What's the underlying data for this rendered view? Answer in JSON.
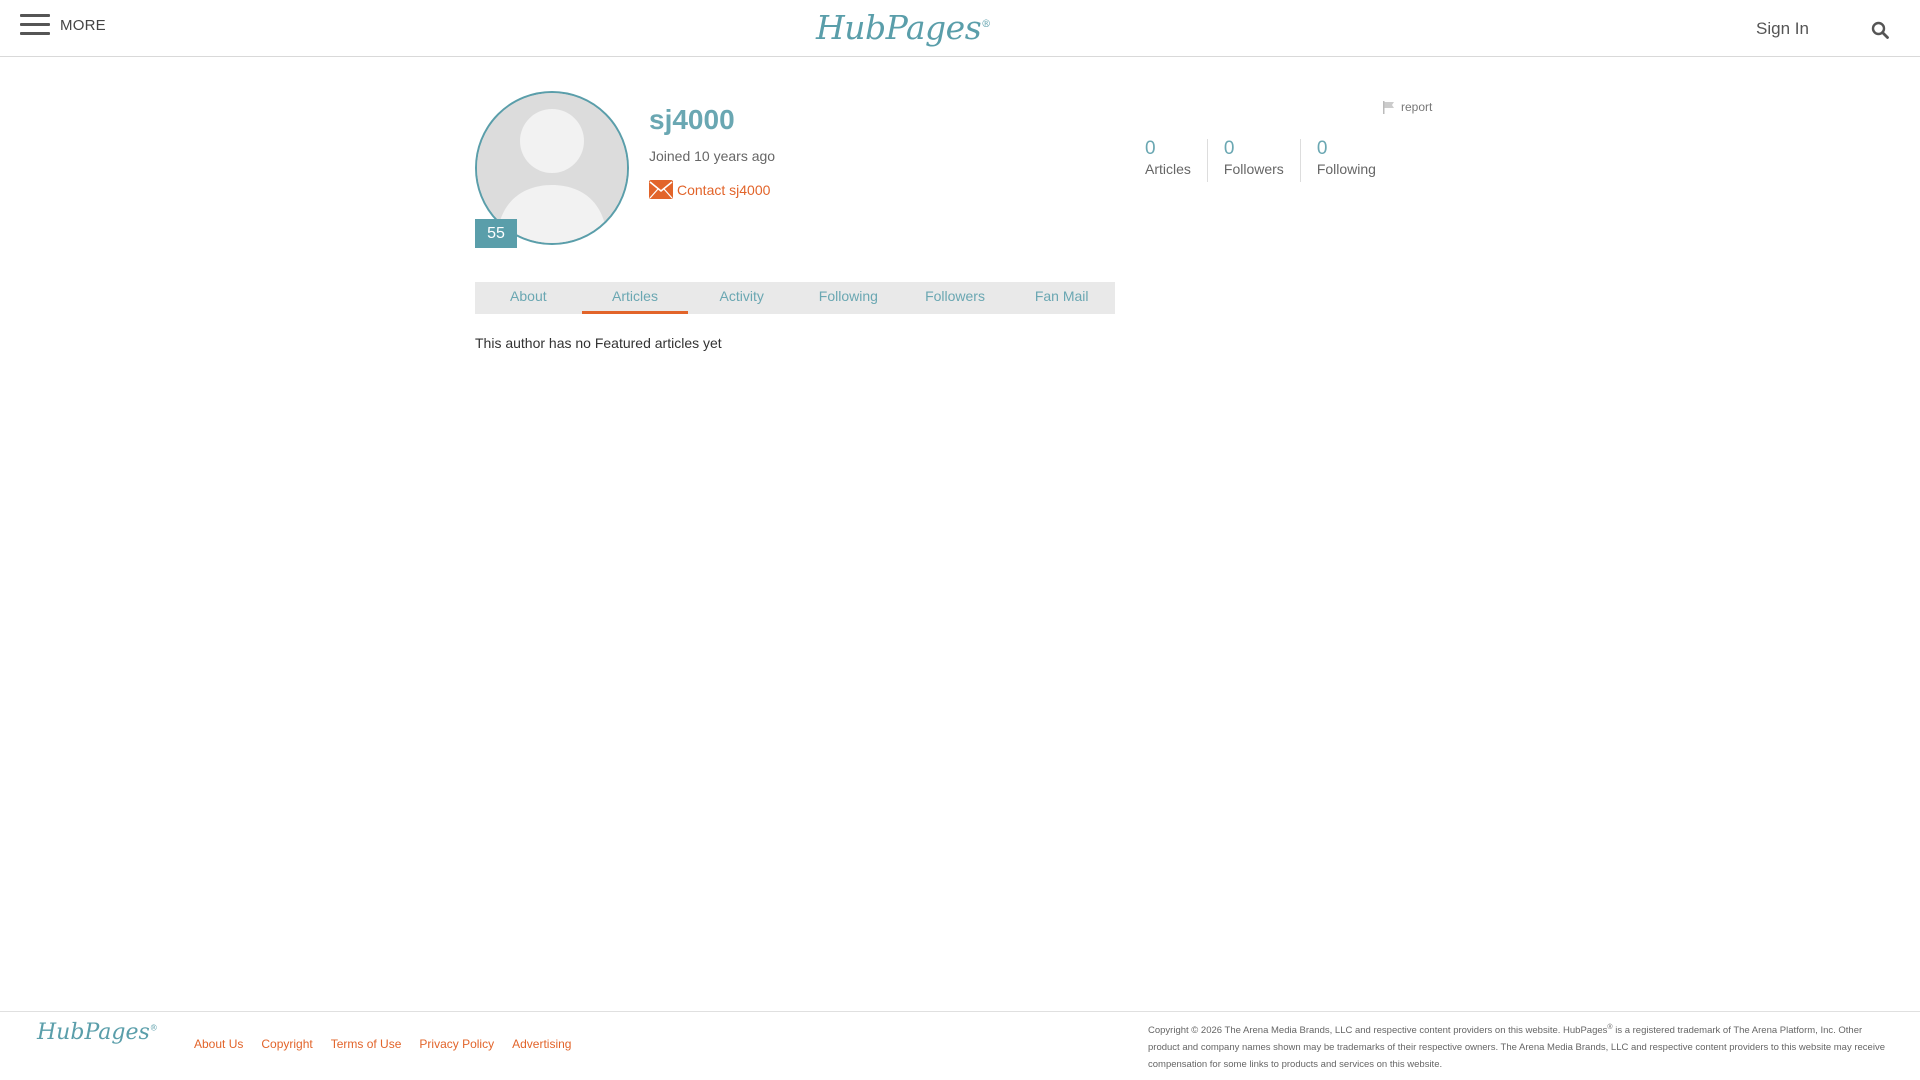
{
  "header": {
    "menu_label": "MORE",
    "logo_text": "HubPages",
    "logo_mark": "®",
    "sign_in_label": "Sign In",
    "search_icon": "search-icon"
  },
  "profile": {
    "username": "sj4000",
    "joined": "Joined 10 years ago",
    "contact_label": "Contact sj4000",
    "score": "55",
    "report_label": "report"
  },
  "stats": [
    {
      "value": "0",
      "label": "Articles"
    },
    {
      "value": "0",
      "label": "Followers"
    },
    {
      "value": "0",
      "label": "Following"
    }
  ],
  "tabs": [
    {
      "label": "About",
      "active": false
    },
    {
      "label": "Articles",
      "active": true
    },
    {
      "label": "Activity",
      "active": false
    },
    {
      "label": "Following",
      "active": false
    },
    {
      "label": "Followers",
      "active": false
    },
    {
      "label": "Fan Mail",
      "active": false
    }
  ],
  "content": {
    "empty_message": "This author has no Featured articles yet"
  },
  "footer": {
    "logo_text": "HubPages",
    "logo_mark": "®",
    "links": [
      "About Us",
      "Copyright",
      "Terms of Use",
      "Privacy Policy",
      "Advertising"
    ],
    "copyright_part1": "Copyright © 2026 The Arena Media Brands, LLC and respective content providers on this website. HubPages",
    "copyright_mark": "®",
    "copyright_part2": " is a registered trademark of The Arena Platform, Inc. Other product and company names shown may be trademarks of their respective owners. The Arena Media Brands, LLC and respective content providers to this website may receive compensation for some links to products and services on this website."
  },
  "colors": {
    "brand_teal": "#5a9eaa",
    "accent_orange": "#e2642a"
  }
}
